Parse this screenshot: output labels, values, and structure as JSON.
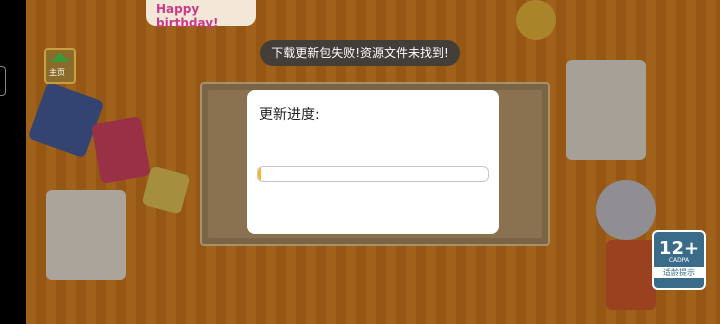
{
  "background": {
    "banner_text": "Happy birthday!",
    "home_label": "主页"
  },
  "toast": {
    "message": "下载更新包失败!资源文件未找到!"
  },
  "dialog": {
    "title": "更新进度:",
    "progress_fraction": 0.01
  },
  "age_rating": {
    "value": "12+",
    "org": "CADPA",
    "tip": "适龄提示"
  },
  "colors": {
    "progress_fill": "#f5b531",
    "toast_bg": "#3c3c3c",
    "age_badge": "#3a6c8a"
  }
}
